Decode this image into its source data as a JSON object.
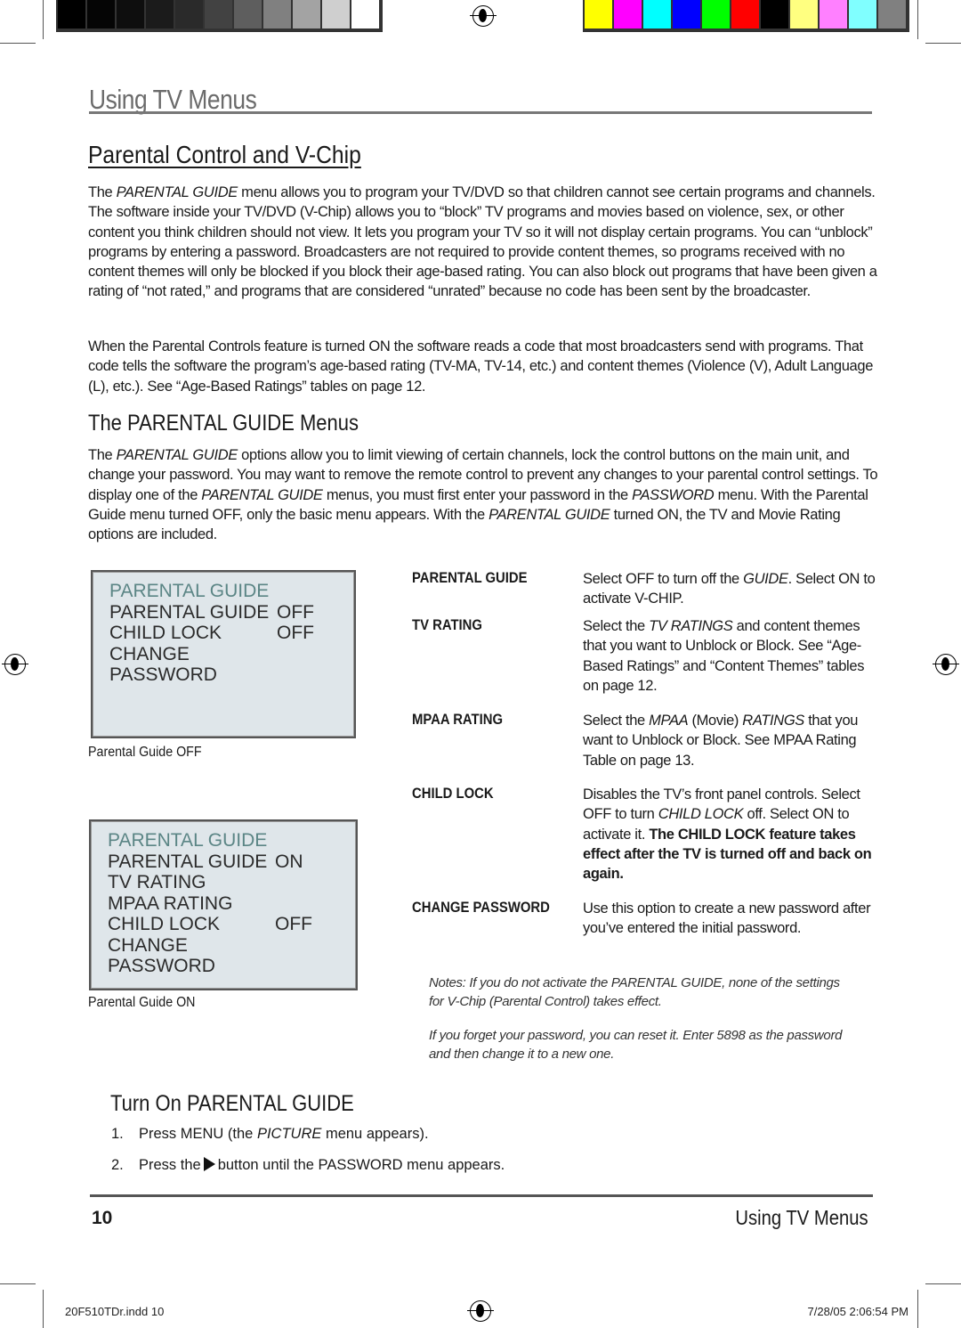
{
  "print_marks": {
    "gray_swatches": [
      "#000000",
      "#050505",
      "#0e0e0e",
      "#1b1b1b",
      "#2a2a2a",
      "#424242",
      "#5e5e5e",
      "#808080",
      "#a3a3a3",
      "#cfcfcf",
      "#ffffff"
    ],
    "color_swatches": [
      "#ffff00",
      "#ff00ff",
      "#00ffff",
      "#0000ff",
      "#00ff00",
      "#ff0000",
      "#000000",
      "#ffff80",
      "#ff80ff",
      "#80ffff",
      "#808080"
    ],
    "slug_file": "20F510TDr.indd   10",
    "slug_date": "7/28/05   2:06:54 PM"
  },
  "header": {
    "title": "Using TV Menus"
  },
  "section": {
    "title": "Parental Control and V-Chip",
    "intro": [
      [
        "The ",
        ""
      ],
      [
        "PARENTAL GUIDE",
        "i"
      ],
      [
        " menu allows you to program your TV/DVD so that children cannot see certain programs and channels. The software inside your TV/DVD (V-Chip) allows you to “block” TV programs and movies based on violence, sex, or other content you think children should not view. It lets you program your TV so it will not display certain programs. You can “unblock” programs by entering a password. Broadcasters are not required to provide content themes, so programs received with no content themes will only be blocked if you block their age-based rating. You can also block out programs that have been given a rating of “not rated,” and programs that are considered “unrated” because no code has been sent by the broadcaster.",
        ""
      ]
    ],
    "intro2": [
      [
        "When the Parental Controls feature is turned ON the software reads a code that most broadcasters send with programs. That code tells the software the program’s age-based rating (TV-MA, TV-14, etc.) and content themes (Violence (V), Adult Language (L), etc.).  See “Age-Based Ratings” tables on page 12.",
        ""
      ]
    ]
  },
  "menus_section": {
    "title": "The PARENTAL GUIDE Menus",
    "body": [
      [
        "The ",
        ""
      ],
      [
        "PARENTAL GUIDE",
        "i"
      ],
      [
        " options allow you to limit viewing of certain channels, lock the control buttons on the main unit, and change your password. You may want to remove the remote control to prevent any changes to your parental control settings. To display one of the ",
        ""
      ],
      [
        "PARENTAL GUIDE",
        "i"
      ],
      [
        " menus, you must first enter your password in the ",
        ""
      ],
      [
        "PASSWORD",
        "i"
      ],
      [
        " menu. With the Parental Guide menu turned OFF, only the basic menu appears. With the ",
        ""
      ],
      [
        "PARENTAL GUIDE",
        "i"
      ],
      [
        " turned ON, the TV and Movie Rating options are included.",
        ""
      ]
    ]
  },
  "osd_off": {
    "title": "PARENTAL GUIDE",
    "rows": [
      [
        "PARENTAL GUIDE",
        "OFF"
      ],
      [
        "CHILD LOCK",
        "OFF"
      ],
      [
        "CHANGE PASSWORD",
        ""
      ]
    ],
    "caption": "Parental Guide OFF"
  },
  "osd_on": {
    "title": "PARENTAL GUIDE",
    "rows": [
      [
        "PARENTAL GUIDE",
        "ON"
      ],
      [
        "TV RATING",
        ""
      ],
      [
        "MPAA RATING",
        ""
      ],
      [
        "CHILD LOCK",
        "OFF"
      ],
      [
        "CHANGE PASSWORD",
        ""
      ]
    ],
    "caption": "Parental Guide ON"
  },
  "options": [
    {
      "label": "PARENTAL GUIDE",
      "desc": [
        [
          "Select OFF to turn off the ",
          ""
        ],
        [
          "GUIDE",
          "i"
        ],
        [
          ". Select ON to activate V-CHIP.",
          ""
        ]
      ]
    },
    {
      "label": "TV RATING",
      "desc": [
        [
          "Select the ",
          ""
        ],
        [
          "TV RATINGS",
          "i"
        ],
        [
          " and content themes that you want to Unblock or Block. See “Age-Based Ratings” and “Content Themes” tables on page 12.",
          ""
        ]
      ]
    },
    {
      "label": "MPAA RATING",
      "desc": [
        [
          "Select the ",
          ""
        ],
        [
          "MPAA",
          "i"
        ],
        [
          " (Movie) ",
          ""
        ],
        [
          "RATINGS",
          "i"
        ],
        [
          " that you want to Unblock or Block. See MPAA Rating Table on page 13.",
          ""
        ]
      ]
    },
    {
      "label": "CHILD LOCK",
      "desc": [
        [
          "Disables the TV’s front panel controls. Select OFF to turn ",
          ""
        ],
        [
          "CHILD LOCK",
          "i"
        ],
        [
          " off. Select ON to activate it. ",
          ""
        ],
        [
          "The CHILD LOCK feature takes effect after the TV is turned off and back on again.",
          "b"
        ]
      ]
    },
    {
      "label": "CHANGE PASSWORD",
      "desc": [
        [
          "Use this option to create a new password after you’ve entered the initial password.",
          ""
        ]
      ]
    }
  ],
  "notes": [
    "Notes: If you do not activate the PARENTAL GUIDE, none of the settings for V-Chip (Parental Control) takes effect.",
    "If you forget your password, you can reset it. Enter 5898 as the password and then change it to a new one."
  ],
  "turn_on": {
    "title": "Turn On PARENTAL GUIDE",
    "steps": [
      {
        "num": "1.",
        "text": [
          [
            "Press MENU (the ",
            ""
          ],
          [
            "PICTURE",
            "i"
          ],
          [
            " menu appears).",
            ""
          ]
        ]
      },
      {
        "num": "2.",
        "before": "Press the",
        "icon": "right-arrow-triangle-icon",
        "after": "button until the PASSWORD menu appears."
      }
    ]
  },
  "footer": {
    "page_number": "10",
    "section": "Using TV Menus"
  }
}
